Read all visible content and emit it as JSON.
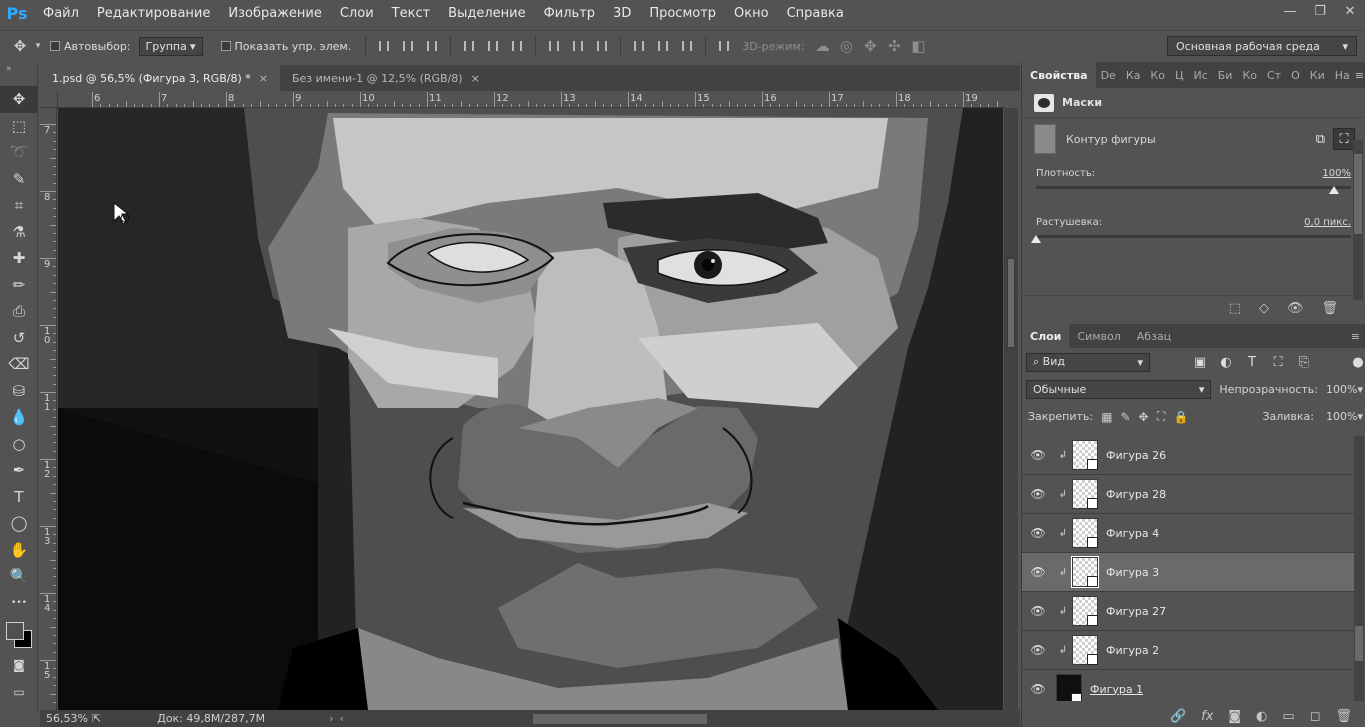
{
  "app": {
    "logo": "Ps"
  },
  "menu": [
    "Файл",
    "Редактирование",
    "Изображение",
    "Слои",
    "Текст",
    "Выделение",
    "Фильтр",
    "3D",
    "Просмотр",
    "Окно",
    "Справка"
  ],
  "window_controls": [
    "—",
    "❐",
    "✕"
  ],
  "options": {
    "autoselect_label": "Автовыбор:",
    "autoselect_value": "Группа",
    "show_controls_label": "Показать упр. элем.",
    "mode3d_label": "3D-режим:",
    "workspace": "Основная рабочая среда"
  },
  "tabs": [
    {
      "label": "1.psd @ 56,5% (Фигура 3, RGB/8) *",
      "close": "×",
      "active": true
    },
    {
      "label": "Без имени-1 @ 12,5% (RGB/8)",
      "close": "×",
      "active": false
    }
  ],
  "ruler": {
    "h": [
      "6",
      "7",
      "8",
      "9",
      "10",
      "11",
      "12",
      "13",
      "14",
      "15",
      "16",
      "17",
      "18",
      "19"
    ],
    "v": [
      "7",
      "8",
      "9",
      "1\n0",
      "1\n1",
      "1\n2",
      "1\n3",
      "1\n4",
      "1\n5"
    ]
  },
  "status": {
    "zoom": "56,53%",
    "doc": "Док: 49,8М/287,7М"
  },
  "properties": {
    "tabs": [
      "Свойства",
      "De",
      "Ка",
      "Ко",
      "Ц",
      "Ис",
      "Би",
      "Ко",
      "Ст",
      "О",
      "Ки",
      "На"
    ],
    "section": "Маски",
    "contour_label": "Контур фигуры",
    "density_label": "Плотность:",
    "density_value": "100%",
    "density": 1.0,
    "feather_label": "Растушевка:",
    "feather_value": "0,0 пикс.",
    "feather": 0.0
  },
  "layers_panel": {
    "tabs": [
      "Слои",
      "Символ",
      "Абзац"
    ],
    "filter": "Вид",
    "blend": "Обычные",
    "opacity_label": "Непрозрачность:",
    "opacity": "100%",
    "lock_label": "Закрепить:",
    "fill_label": "Заливка:",
    "fill": "100%",
    "layers": [
      {
        "name": "Фигура 26",
        "selected": false
      },
      {
        "name": "Фигура 28",
        "selected": false
      },
      {
        "name": "Фигура 4",
        "selected": false
      },
      {
        "name": "Фигура 3",
        "selected": true
      },
      {
        "name": "Фигура 27",
        "selected": false
      },
      {
        "name": "Фигура 2",
        "selected": false
      },
      {
        "name": "Фигура 1",
        "selected": false
      }
    ]
  },
  "icons": {
    "move": "✥",
    "marquee": "⬚",
    "lasso": "➰",
    "quick_select": "✎",
    "crop": "⌗",
    "eyedropper": "⚗",
    "healing": "✚",
    "brush": "✏",
    "stamp": "⎙",
    "history": "↺",
    "eraser": "⌫",
    "bucket": "⛁",
    "blur": "💧",
    "dodge": "○",
    "pen": "✒",
    "type": "T",
    "shape": "◯",
    "hand": "✋",
    "zoom": "🔍",
    "more": "•••",
    "eye": "👁",
    "clip": "↲",
    "link": "🔗",
    "fx": "fx",
    "mask": "◙",
    "adjust": "◐",
    "folder": "▭",
    "new": "◻",
    "trash": "🗑",
    "menu": "≡",
    "search": "⌕"
  }
}
